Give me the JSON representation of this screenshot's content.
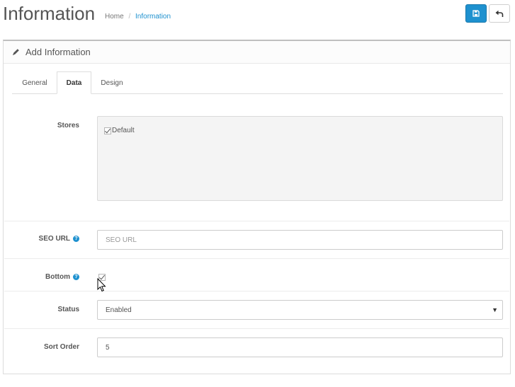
{
  "header": {
    "title": "Information",
    "breadcrumb": {
      "home": "Home",
      "separator": "/",
      "current": "Information"
    }
  },
  "toolbar": {
    "save_icon": "save-icon",
    "back_icon": "back-icon"
  },
  "panel": {
    "title": "Add Information",
    "icon": "pencil-icon"
  },
  "tabs": [
    {
      "label": "General",
      "active": false
    },
    {
      "label": "Data",
      "active": true
    },
    {
      "label": "Design",
      "active": false
    }
  ],
  "form": {
    "stores": {
      "label": "Stores",
      "option_label": "Default",
      "checked": true
    },
    "seo_url": {
      "label": "SEO URL",
      "placeholder": "SEO URL",
      "value": ""
    },
    "bottom": {
      "label": "Bottom",
      "checked": true
    },
    "status": {
      "label": "Status",
      "value": "Enabled"
    },
    "sort_order": {
      "label": "Sort Order",
      "value": "5"
    }
  },
  "colors": {
    "accent": "#1e91cf"
  }
}
